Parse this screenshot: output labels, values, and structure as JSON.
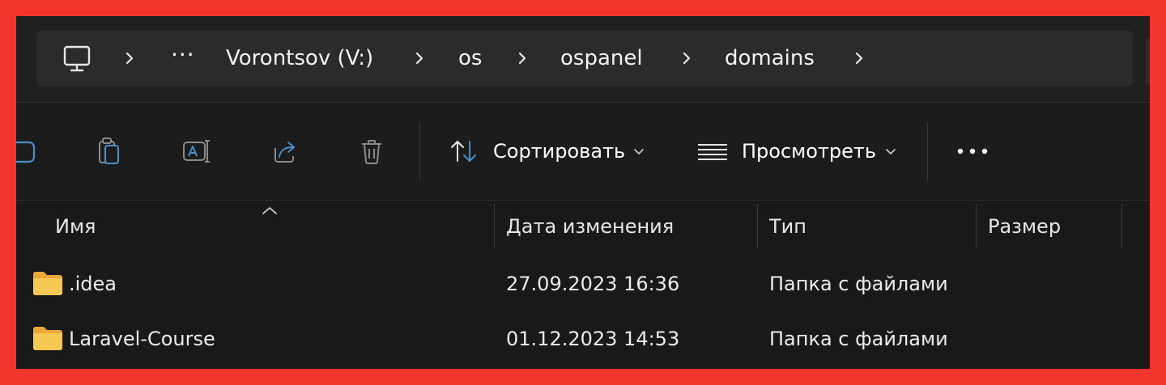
{
  "address_bar": {
    "overflow_label": "···",
    "crumbs": [
      {
        "label": "Vorontsov (V:)"
      },
      {
        "label": "os"
      },
      {
        "label": "ospanel"
      },
      {
        "label": "domains"
      }
    ]
  },
  "toolbar": {
    "sort_label": "Сортировать",
    "view_label": "Просмотреть",
    "more_label": "···"
  },
  "columns": {
    "name": "Имя",
    "date": "Дата изменения",
    "type": "Тип",
    "size": "Размер"
  },
  "files": [
    {
      "name": ".idea",
      "date": "27.09.2023 16:36",
      "type": "Папка с файлами",
      "size": ""
    },
    {
      "name": "Laravel-Course",
      "date": "01.12.2023 14:53",
      "type": "Папка с файлами",
      "size": ""
    }
  ],
  "colors": {
    "frame": "#f2352e",
    "window_bg": "#191919",
    "address_bg": "#2b2b2b",
    "folder": "#f3c14b"
  },
  "icons": [
    "computer-icon",
    "chevron-right-icon",
    "cut-icon",
    "paste-icon",
    "rename-icon",
    "share-icon",
    "delete-icon",
    "sort-icon",
    "view-lines-icon",
    "chevron-down-icon",
    "more-icon",
    "folder-icon",
    "sort-ascending-icon"
  ]
}
